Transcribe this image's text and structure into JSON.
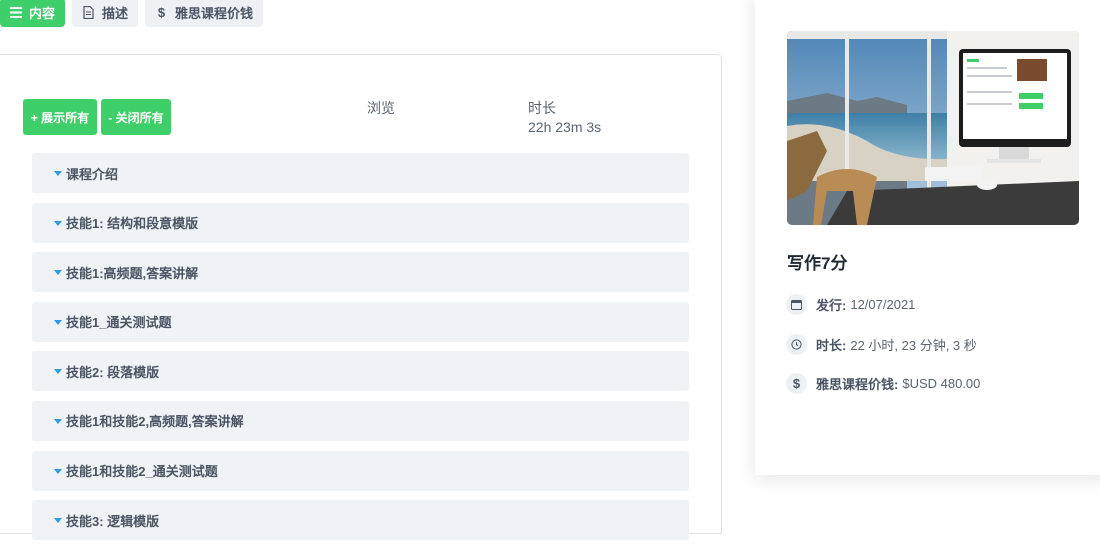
{
  "tabs": [
    {
      "label": "内容",
      "icon": "list-icon",
      "active": true
    },
    {
      "label": "描述",
      "icon": "document-icon",
      "active": false
    },
    {
      "label": "雅思课程价钱",
      "icon": "dollar-icon",
      "active": false
    }
  ],
  "curriculum": {
    "expand_all": "+ 展示所有",
    "collapse_all": "- 关闭所有",
    "views_header": "浏览",
    "duration_header": "时长",
    "total_duration": "22h 23m 3s",
    "sections": [
      "课程介绍",
      "技能1: 结构和段意模版",
      "技能1:高频题,答案讲解",
      "技能1_通关测试题",
      "技能2: 段落模版",
      "技能1和技能2,高频题,答案讲解",
      "技能1和技能2_通关测试题",
      "技能3: 逻辑模版"
    ]
  },
  "course": {
    "title": "写作7分",
    "release_label": "发行:",
    "release_value": "12/07/2021",
    "duration_label": "时长:",
    "duration_value": "22 小时, 23 分钟, 3 秒",
    "price_label": "雅思课程价钱:",
    "price_value": "$USD 480.00"
  },
  "colors": {
    "accent_green": "#3ecf6b",
    "caret_blue": "#2d9be0"
  }
}
